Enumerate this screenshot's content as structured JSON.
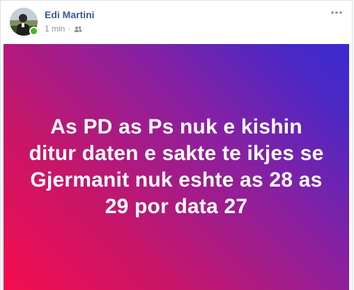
{
  "post": {
    "author": {
      "name": "Edi Martini",
      "online": true
    },
    "meta": {
      "time": "1 min",
      "separator": "·",
      "audience_icon": "friends-icon"
    },
    "menu_icon": "more-horizontal-icon",
    "body": {
      "text": "As PD as Ps nuk e kishin ditur daten e sakte te ikjes se Gjermanit nuk eshte as 28 as 29 por data 27",
      "background_colors": [
        "#f50c4d",
        "#8a20a0",
        "#3a2bcf"
      ],
      "text_color": "#ffffff"
    },
    "colors": {
      "name_link": "#365899",
      "meta_text": "#90949c",
      "online_indicator": "#42b72a"
    }
  }
}
